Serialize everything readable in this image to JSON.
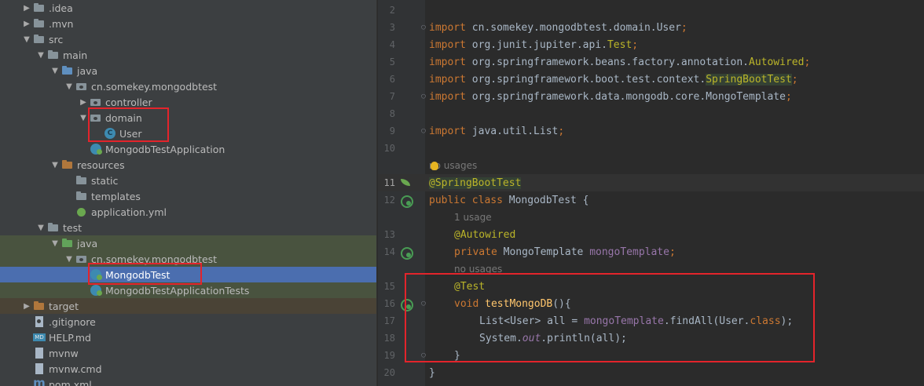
{
  "project_tree": {
    "items": [
      {
        "label": ".idea"
      },
      {
        "label": ".mvn"
      },
      {
        "label": "src"
      },
      {
        "label": "main"
      },
      {
        "label": "java"
      },
      {
        "label": "cn.somekey.mongodbtest"
      },
      {
        "label": "controller"
      },
      {
        "label": "domain"
      },
      {
        "label": "User"
      },
      {
        "label": "MongodbTestApplication"
      },
      {
        "label": "resources"
      },
      {
        "label": "static"
      },
      {
        "label": "templates"
      },
      {
        "label": "application.yml"
      },
      {
        "label": "test"
      },
      {
        "label": "java"
      },
      {
        "label": "cn.somekey.mongodbtest"
      },
      {
        "label": "MongodbTest"
      },
      {
        "label": "MongodbTestApplicationTests"
      },
      {
        "label": "target"
      },
      {
        "label": ".gitignore"
      },
      {
        "label": "HELP.md"
      },
      {
        "label": "mvnw"
      },
      {
        "label": "mvnw.cmd"
      },
      {
        "label": "pom.xml"
      }
    ]
  },
  "editor": {
    "line_numbers": [
      "2",
      "3",
      "4",
      "5",
      "6",
      "7",
      "8",
      "9",
      "10",
      "11",
      "12",
      "13",
      "14",
      "15",
      "16",
      "17",
      "18",
      "19",
      "20"
    ],
    "hints": {
      "no_usages_1": "no usages",
      "one_usage": "1 usage",
      "no_usages_2": "no usages"
    },
    "code": {
      "l3": {
        "kw": "import",
        "path": " cn.somekey.mongodbtest.domain.User",
        "semi": ";"
      },
      "l4": {
        "kw": "import",
        "path": " org.junit.jupiter.api.",
        "ann": "Test",
        "semi": ";"
      },
      "l5": {
        "kw": "import",
        "path": " org.springframework.beans.factory.annotation.",
        "ann": "Autowired",
        "semi": ";"
      },
      "l6": {
        "kw": "import",
        "path": " org.springframework.boot.test.context.",
        "ann": "SpringBootTest",
        "semi": ";"
      },
      "l7": {
        "kw": "import",
        "path": " org.springframework.data.mongodb.core.MongoTemplate",
        "semi": ";"
      },
      "l9": {
        "kw": "import",
        "path": " java.util.List",
        "semi": ";"
      },
      "l11": {
        "ann": "@SpringBootTest"
      },
      "l12": {
        "kw1": "public",
        "kw2": " class",
        "rest": " MongodbTest {"
      },
      "l13": {
        "ann": "@Autowired"
      },
      "l14": {
        "kw": "private",
        "type": " MongoTemplate ",
        "field": "mongoTemplate",
        "semi": ";"
      },
      "l15": {
        "ann": "@Test"
      },
      "l16": {
        "kw": "void",
        "sp": " ",
        "fn": "testMongoDB",
        "rest": "(){"
      },
      "l17": {
        "a": "List<User> all = ",
        "field": "mongoTemplate",
        "b": ".findAll(User.",
        "kw": "class",
        "c": ");"
      },
      "l18": {
        "a": "System.",
        "field": "out",
        "b": ".println(all);"
      },
      "l19": {
        "a": "}"
      },
      "l20": {
        "a": "}"
      }
    }
  },
  "colors": {
    "panel_bg": "#3c3f41",
    "editor_bg": "#2b2b2b",
    "selection": "#4b6eaf",
    "highlight_box": "#e3242b",
    "keyword": "#cc7832",
    "annotation": "#bbb529"
  }
}
